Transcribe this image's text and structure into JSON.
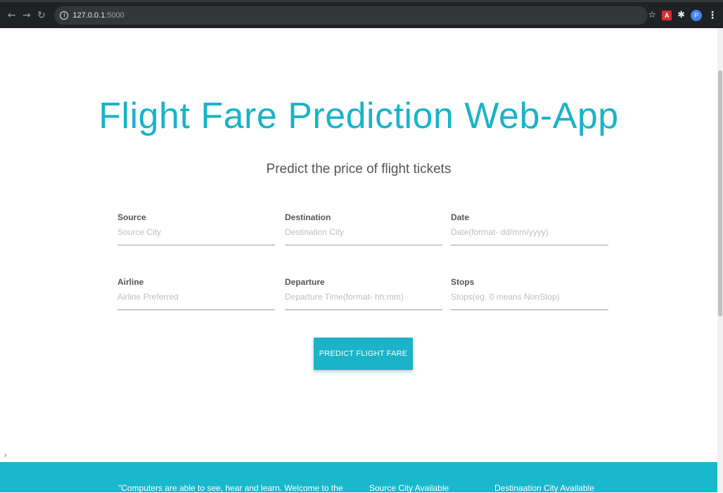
{
  "browser": {
    "url_host": "127.0.0.1",
    "url_port": ":5000",
    "profile_initial": "P"
  },
  "page": {
    "title": "Flight Fare Prediction Web-App",
    "subtitle": "Predict the price of flight tickets"
  },
  "form": {
    "source": {
      "label": "Source",
      "placeholder": "Source City"
    },
    "destination": {
      "label": "Destination",
      "placeholder": "Destination City"
    },
    "date": {
      "label": "Date",
      "placeholder": "Date(format- dd/mm/yyyy)"
    },
    "airline": {
      "label": "Airline",
      "placeholder": "Airline Preferred"
    },
    "departure": {
      "label": "Departure",
      "placeholder": "Departure Time(format- hh:mm)"
    },
    "stops": {
      "label": "Stops",
      "placeholder": "Stops(eg. 0 means NonStop)"
    },
    "submit_label": "PREDICT FLIGHT FARE"
  },
  "footer": {
    "quote": "\"Computers are able to see, hear and learn. Welcome to the",
    "source_heading": "Source City Available",
    "destination_heading": "Destinaation City Available"
  },
  "colors": {
    "accent": "#1ab3c8",
    "footer": "#1ab8cd"
  }
}
